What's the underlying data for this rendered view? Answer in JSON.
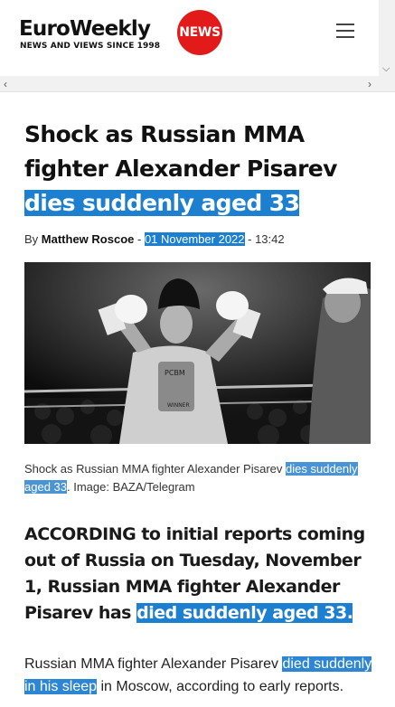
{
  "header": {
    "logo_main": "EuroWeekly",
    "logo_badge": "NEWS",
    "logo_tagline": "NEWS AND VIEWS SINCE 1998",
    "menu_icon": "hamburger-menu-icon"
  },
  "scrollbars": {
    "down_icon": "chevron-down-icon",
    "left_icon": "chevron-left-icon",
    "right_icon": "chevron-right-icon"
  },
  "article": {
    "headline_part1": "Shock as Russian MMA fighter Alexander Pisarev ",
    "headline_highlight": "dies suddenly aged 33",
    "byline_prefix": "By ",
    "author": "Matthew Roscoe",
    "separator1": " - ",
    "date": "01 November 2022",
    "separator2": " - ",
    "time": "13:42",
    "image_alt": "Fighter in boxing gloves wearing a fur hat inside a ring",
    "caption_part1": "Shock as Russian MMA fighter Alexander Pisarev ",
    "caption_highlight": "dies suddenly aged 33",
    "caption_part2": ". Image: BAZA/Telegram",
    "lead_part1": "ACCORDING to initial reports coming out of Russia on Tuesday, November 1, Russian MMA fighter Alexander Pisarev has ",
    "lead_highlight": "died suddenly aged 33.",
    "para_part1": "Russian MMA fighter Alexander Pisarev ",
    "para_highlight": "died suddenly in his sleep",
    "para_part2": " in Moscow, according to early reports."
  },
  "colors": {
    "brand_red": "#e21a1a",
    "highlight_blue": "#1c7fd0"
  }
}
